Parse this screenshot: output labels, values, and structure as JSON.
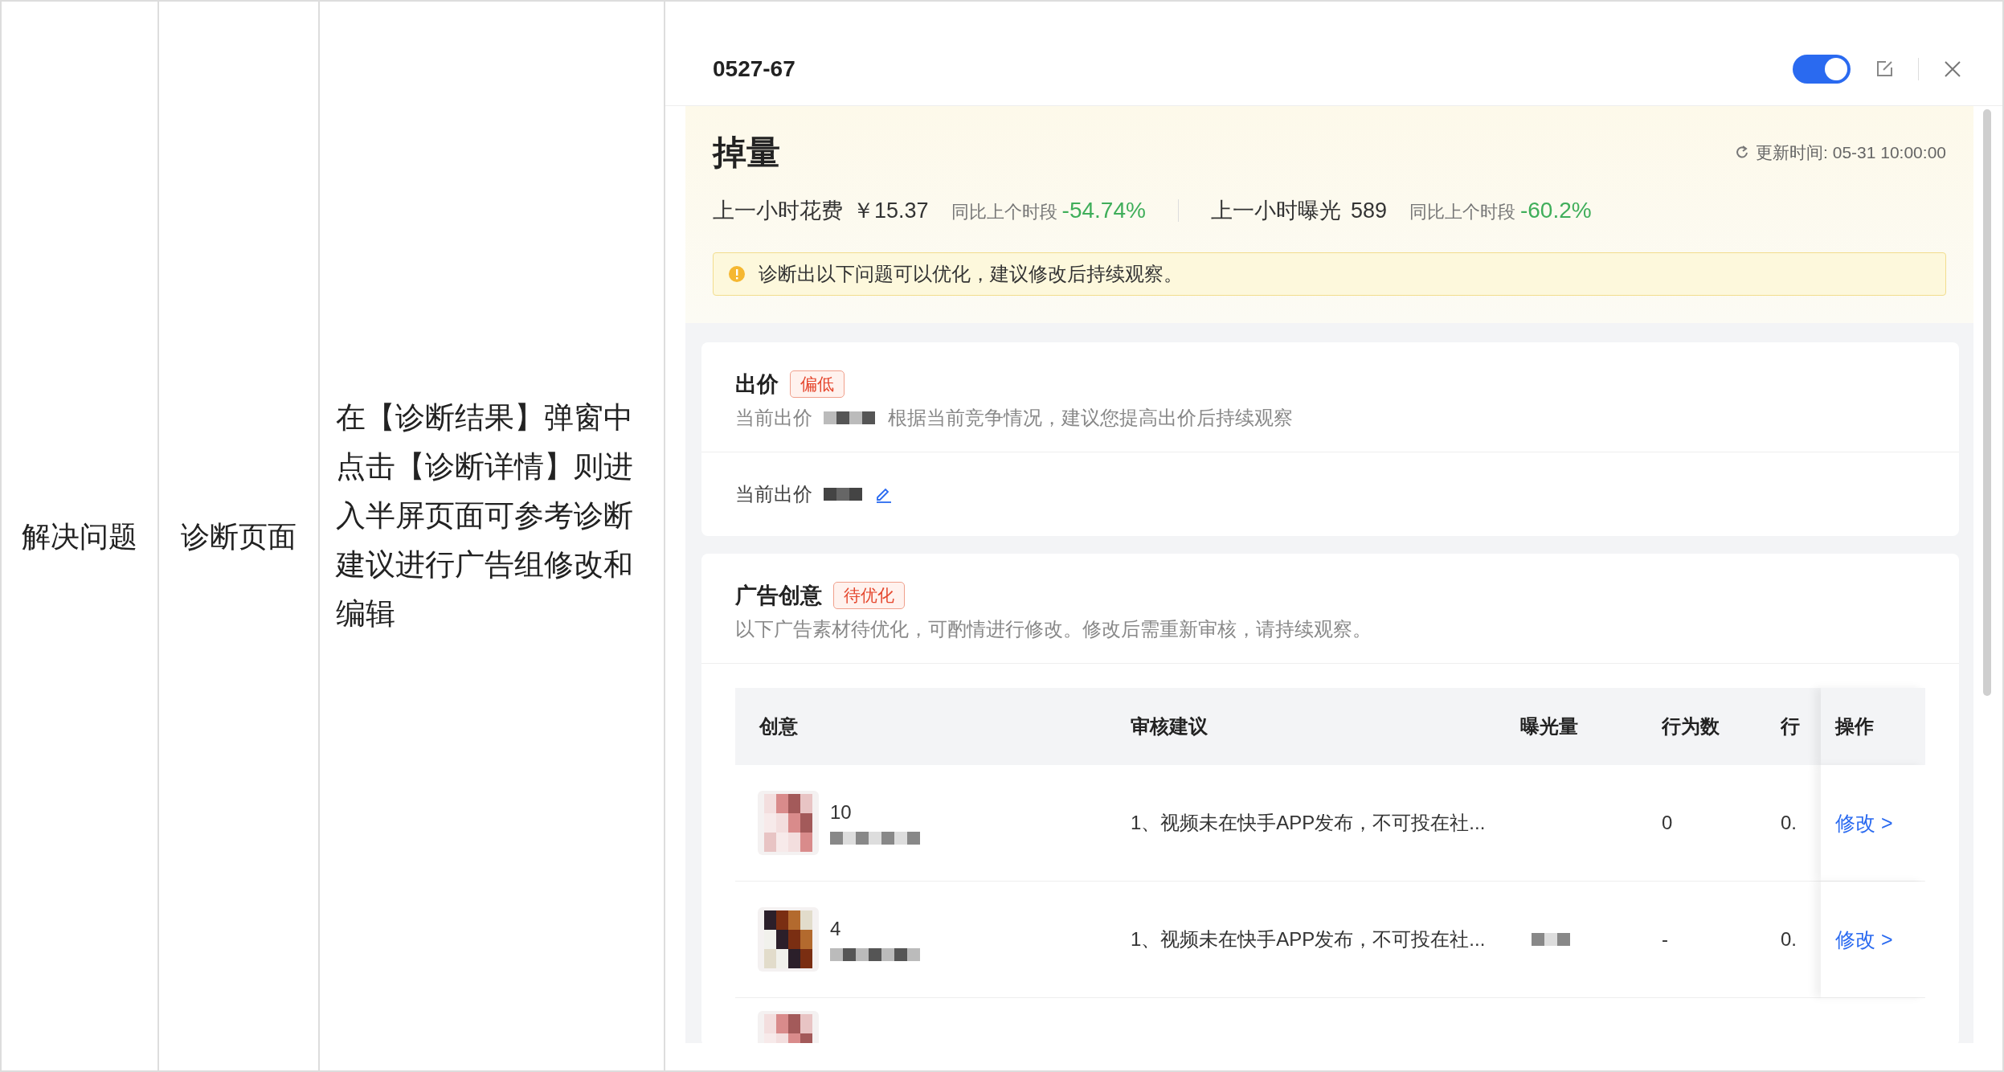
{
  "outer_table": {
    "cells": [
      "解决问题",
      "诊断页面",
      "在【诊断结果】弹窗中点击【诊断详情】则进入半屏页面可参考诊断建议进行广告组修改和编辑"
    ]
  },
  "panel": {
    "title": "0527-67",
    "toggle": {
      "on": true
    },
    "summary": {
      "title": "掉量",
      "update_time": "更新时间: 05-31 10:00:00",
      "metrics": [
        {
          "label": "上一小时花费",
          "value": "￥15.37",
          "compare_label": "同比上个时段",
          "change": "-54.74%"
        },
        {
          "label": "上一小时曝光",
          "value": "589",
          "compare_label": "同比上个时段",
          "change": "-60.2%"
        }
      ],
      "alert": "诊断出以下问题可以优化，建议修改后持续观察。"
    },
    "bid_card": {
      "title": "出价",
      "tag": "偏低",
      "desc_label": "当前出价",
      "description": "根据当前竞争情况，建议您提高出价后持续观察",
      "current_label": "当前出价"
    },
    "creative_card": {
      "title": "广告创意",
      "tag": "待优化",
      "description": "以下广告素材待优化，可酌情进行修改。修改后需重新审核，请持续观察。",
      "table": {
        "columns": [
          "创意",
          "审核建议",
          "曝光量",
          "行为数",
          "行",
          "操作"
        ],
        "rows": [
          {
            "kind": "full",
            "title": "10",
            "suggestion": "1、视频未在快手APP发布，不可投在社...",
            "behavior": "0",
            "column_5": "0.",
            "action": "修改 >",
            "exposure_redacted": false
          },
          {
            "kind": "full",
            "title": "4",
            "suggestion": "1、视频未在快手APP发布，不可投在社...",
            "exposure_redacted": true,
            "behavior": "-",
            "column_5": "0.",
            "action": "修改 >"
          },
          {
            "kind": "partial"
          }
        ]
      }
    }
  }
}
